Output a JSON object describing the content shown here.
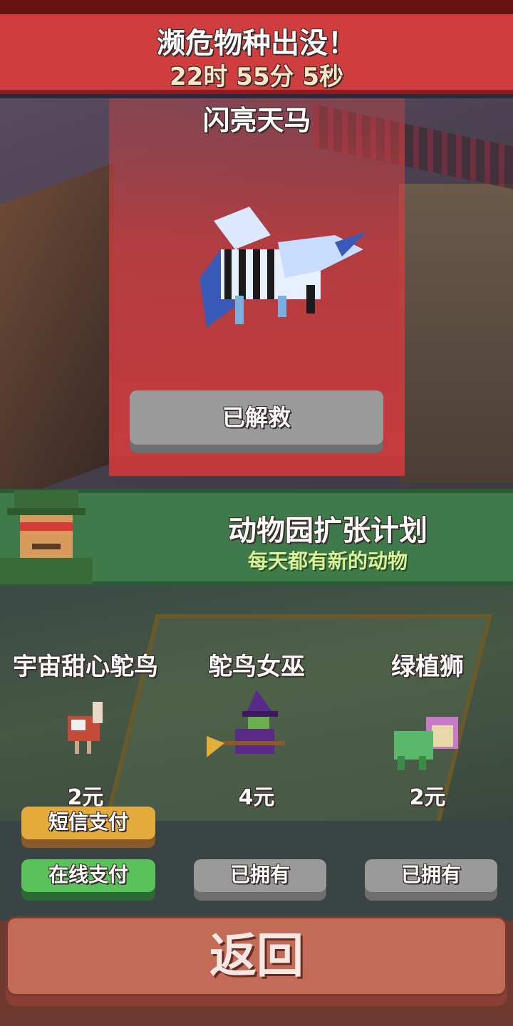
{
  "banner": {
    "title": "濒危物种出没！",
    "timer": "22时 55分 5秒"
  },
  "rescue": {
    "animal_name": "闪亮天马",
    "status_button": "已解救"
  },
  "expansion": {
    "title": "动物园扩张计划",
    "subtitle": "每天都有新的动物"
  },
  "animals": [
    {
      "name": "宇宙甜心鸵鸟",
      "price": "2元",
      "buttons": [
        "短信支付",
        "在线支付"
      ]
    },
    {
      "name": "鸵鸟女巫",
      "price": "4元",
      "buttons": [
        "已拥有"
      ]
    },
    {
      "name": "绿植狮",
      "price": "2元",
      "buttons": [
        "已拥有"
      ]
    }
  ],
  "back_button": "返回",
  "colors": {
    "banner_red": "#cf3d3f",
    "panel_green": "#3f7a4a",
    "button_yellow": "#e2ab3c",
    "button_green": "#59c25a",
    "button_gray": "#9a9a9a",
    "back_button": "#c26b56"
  }
}
